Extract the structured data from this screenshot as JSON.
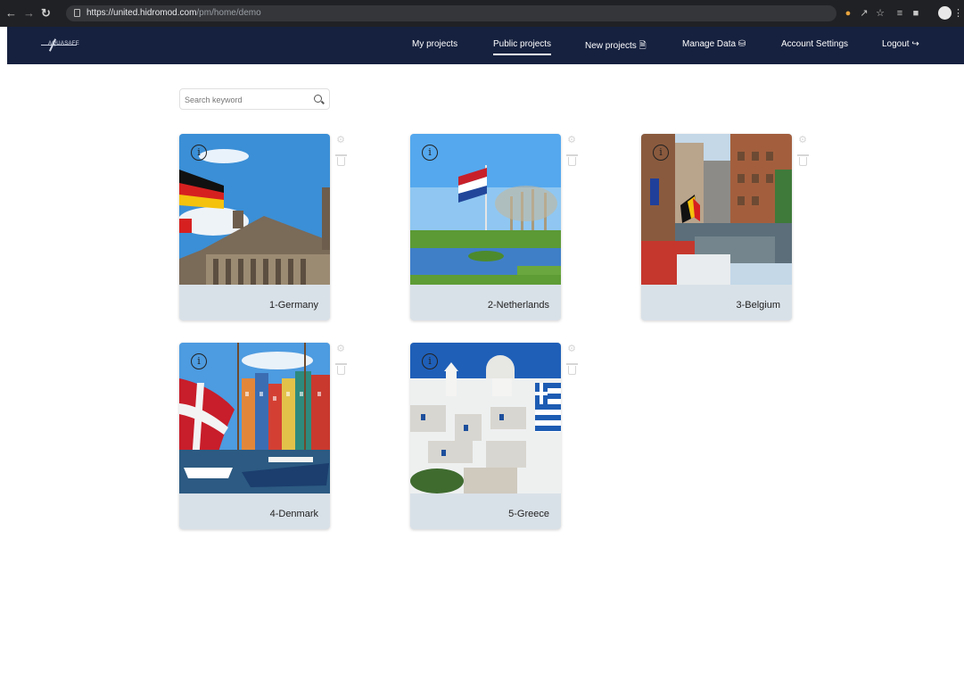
{
  "browser": {
    "url_host": "https://united.hidromod.com",
    "url_path": "/pm/home/demo",
    "icons": [
      "back-arrow-icon",
      "forward-arrow-icon",
      "reload-icon",
      "lock-icon",
      "google-icon",
      "share-icon",
      "star-icon",
      "playlist-icon",
      "sidebar-icon",
      "profile-icon",
      "menu-icon"
    ]
  },
  "nav": {
    "logo": "AQUASAFE",
    "items": [
      {
        "label": "My projects"
      },
      {
        "label": "Public projects"
      },
      {
        "label": "New projects"
      },
      {
        "label": "Manage Data"
      },
      {
        "label": "Account Settings"
      },
      {
        "label": "Logout"
      }
    ]
  },
  "search": {
    "placeholder": "Search keyword"
  },
  "projects": [
    {
      "name": "1-Germany"
    },
    {
      "name": "2-Netherlands"
    },
    {
      "name": "3-Belgium"
    },
    {
      "name": "4-Denmark"
    },
    {
      "name": "5-Greece"
    }
  ],
  "colors": {
    "nav_bg": "#16213f",
    "card_footer": "#d9e1e8",
    "chrome_bg": "#202124"
  }
}
